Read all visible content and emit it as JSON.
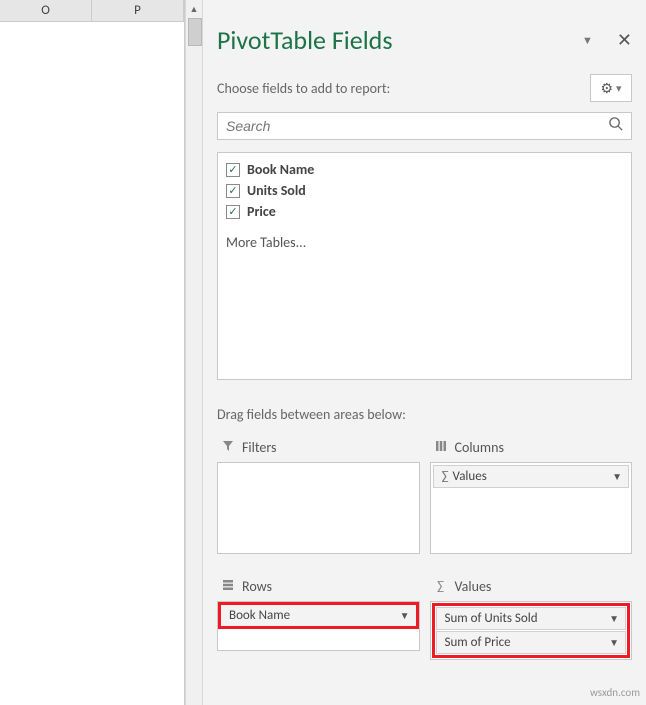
{
  "sheet": {
    "columns": [
      "O",
      "P"
    ]
  },
  "pane": {
    "title": "PivotTable Fields",
    "choose_label": "Choose fields to add to report:",
    "search_placeholder": "Search",
    "more_tables": "More Tables...",
    "drag_label": "Drag fields between areas below:",
    "fields": [
      {
        "label": "Book Name",
        "checked": true
      },
      {
        "label": "Units Sold",
        "checked": true
      },
      {
        "label": "Price",
        "checked": true
      }
    ],
    "areas": {
      "filters": {
        "title": "Filters",
        "items": []
      },
      "columns": {
        "title": "Columns",
        "items": [
          "Values"
        ]
      },
      "rows": {
        "title": "Rows",
        "items": [
          "Book Name"
        ]
      },
      "values": {
        "title": "Values",
        "items": [
          "Sum of Units Sold",
          "Sum of Price"
        ]
      }
    }
  },
  "watermark": "wsxdn.com"
}
